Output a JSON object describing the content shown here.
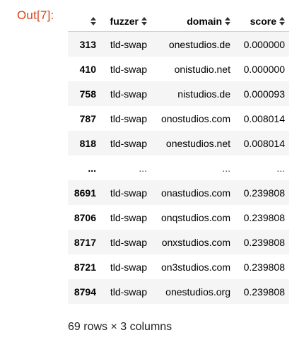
{
  "cell": {
    "prompt_label": "Out[7]:"
  },
  "dataframe": {
    "columns": [
      "fuzzer",
      "domain",
      "score"
    ],
    "rows": [
      {
        "index": "313",
        "fuzzer": "tld-swap",
        "domain": "onestudios.de",
        "score": "0.000000"
      },
      {
        "index": "410",
        "fuzzer": "tld-swap",
        "domain": "onistudio.net",
        "score": "0.000000"
      },
      {
        "index": "758",
        "fuzzer": "tld-swap",
        "domain": "nistudios.de",
        "score": "0.000093"
      },
      {
        "index": "787",
        "fuzzer": "tld-swap",
        "domain": "onostudios.com",
        "score": "0.008014"
      },
      {
        "index": "818",
        "fuzzer": "tld-swap",
        "domain": "onestudios.net",
        "score": "0.008014"
      },
      {
        "index": "...",
        "fuzzer": "...",
        "domain": "...",
        "score": "..."
      },
      {
        "index": "8691",
        "fuzzer": "tld-swap",
        "domain": "onastudios.com",
        "score": "0.239808"
      },
      {
        "index": "8706",
        "fuzzer": "tld-swap",
        "domain": "onqstudios.com",
        "score": "0.239808"
      },
      {
        "index": "8717",
        "fuzzer": "tld-swap",
        "domain": "onxstudios.com",
        "score": "0.239808"
      },
      {
        "index": "8721",
        "fuzzer": "tld-swap",
        "domain": "on3studios.com",
        "score": "0.239808"
      },
      {
        "index": "8794",
        "fuzzer": "tld-swap",
        "domain": "onestudios.org",
        "score": "0.239808"
      }
    ],
    "shape_summary": "69 rows × 3 columns"
  },
  "icons": {
    "sort": "sort-arrows-icon"
  },
  "colors": {
    "prompt": "#d84315",
    "row_stripe": "#f5f5f5"
  }
}
